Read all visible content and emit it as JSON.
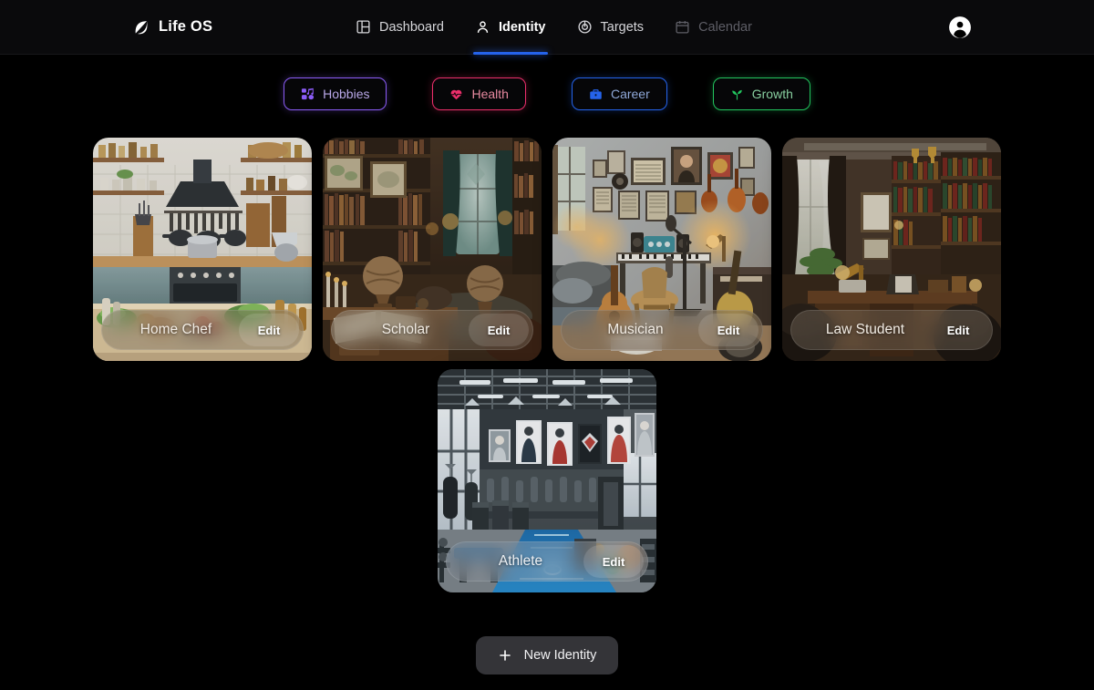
{
  "header": {
    "brand": {
      "name": "Life OS",
      "icon": "leaf-icon"
    },
    "nav": [
      {
        "label": "Dashboard",
        "icon": "layout-dashboard-icon",
        "active": false,
        "dim": false
      },
      {
        "label": "Identity",
        "icon": "user-icon",
        "active": true,
        "dim": false
      },
      {
        "label": "Targets",
        "icon": "target-icon",
        "active": false,
        "dim": false
      },
      {
        "label": "Calendar",
        "icon": "calendar-icon",
        "active": false,
        "dim": true
      }
    ],
    "avatar_icon": "user-circle-icon",
    "active_underline_color": "#2563eb"
  },
  "filters": [
    {
      "label": "Hobbies",
      "icon": "game-music-icon",
      "color": "#8b5cf6"
    },
    {
      "label": "Health",
      "icon": "heart-pulse-icon",
      "color": "#ec2f6b"
    },
    {
      "label": "Career",
      "icon": "briefcase-icon",
      "color": "#2563eb"
    },
    {
      "label": "Growth",
      "icon": "seedling-icon",
      "color": "#22c55e"
    }
  ],
  "identities": [
    {
      "title": "Home Chef",
      "edit_label": "Edit",
      "scene": "kitchen"
    },
    {
      "title": "Scholar",
      "edit_label": "Edit",
      "scene": "library"
    },
    {
      "title": "Musician",
      "edit_label": "Edit",
      "scene": "music-room"
    },
    {
      "title": "Law Student",
      "edit_label": "Edit",
      "scene": "law-office"
    },
    {
      "title": "Athlete",
      "edit_label": "Edit",
      "scene": "gym"
    }
  ],
  "footer": {
    "new_identity_label": "New Identity",
    "new_identity_icon": "plus-icon"
  }
}
